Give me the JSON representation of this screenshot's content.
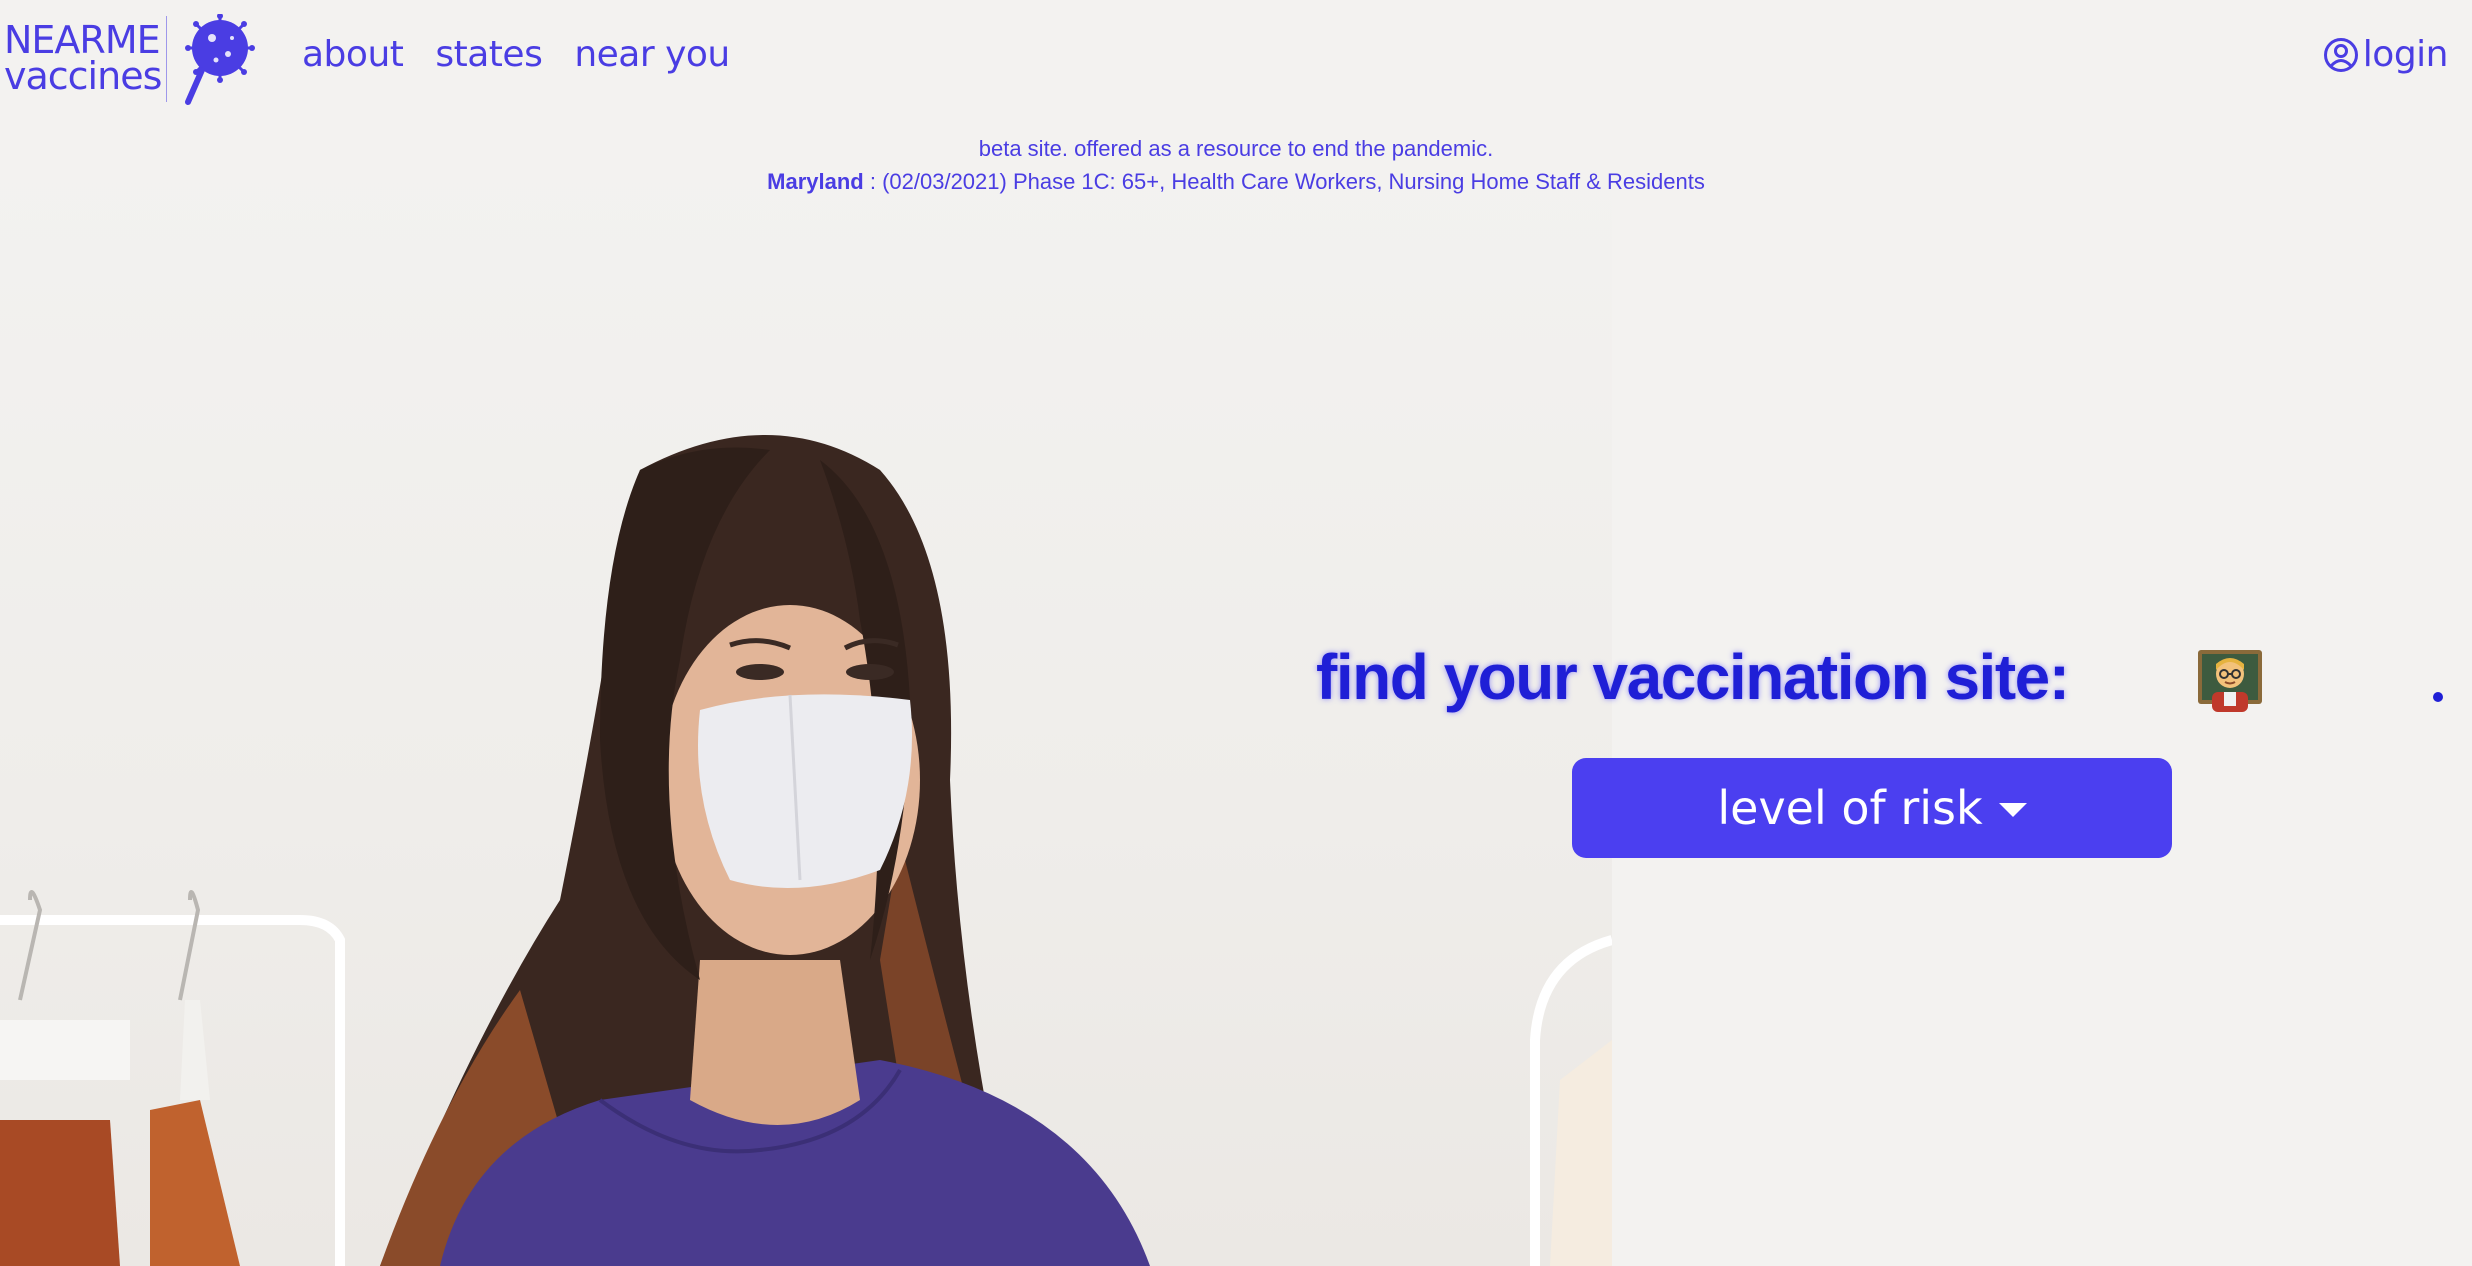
{
  "brand": {
    "line1": "NEARME",
    "line2": "vaccines",
    "accent_color": "#4a3de3"
  },
  "nav": {
    "items": [
      {
        "label": "about"
      },
      {
        "label": "states"
      },
      {
        "label": "near you"
      }
    ]
  },
  "account": {
    "login_label": "login",
    "icon": "user-circle-icon"
  },
  "banner": {
    "line1": "beta site. offered as a resource to end the pandemic.",
    "state": "Maryland",
    "phase_text": " : (02/03/2021) Phase 1C: 65+, Health Care Workers, Nursing Home Staff & Residents"
  },
  "search": {
    "heading": "find your vaccination site:",
    "emoji_icon": "teacher-emoji-icon",
    "risk_button_label": "level of risk",
    "button_color": "#4b3ff0",
    "heading_color": "#1f1fd6"
  }
}
